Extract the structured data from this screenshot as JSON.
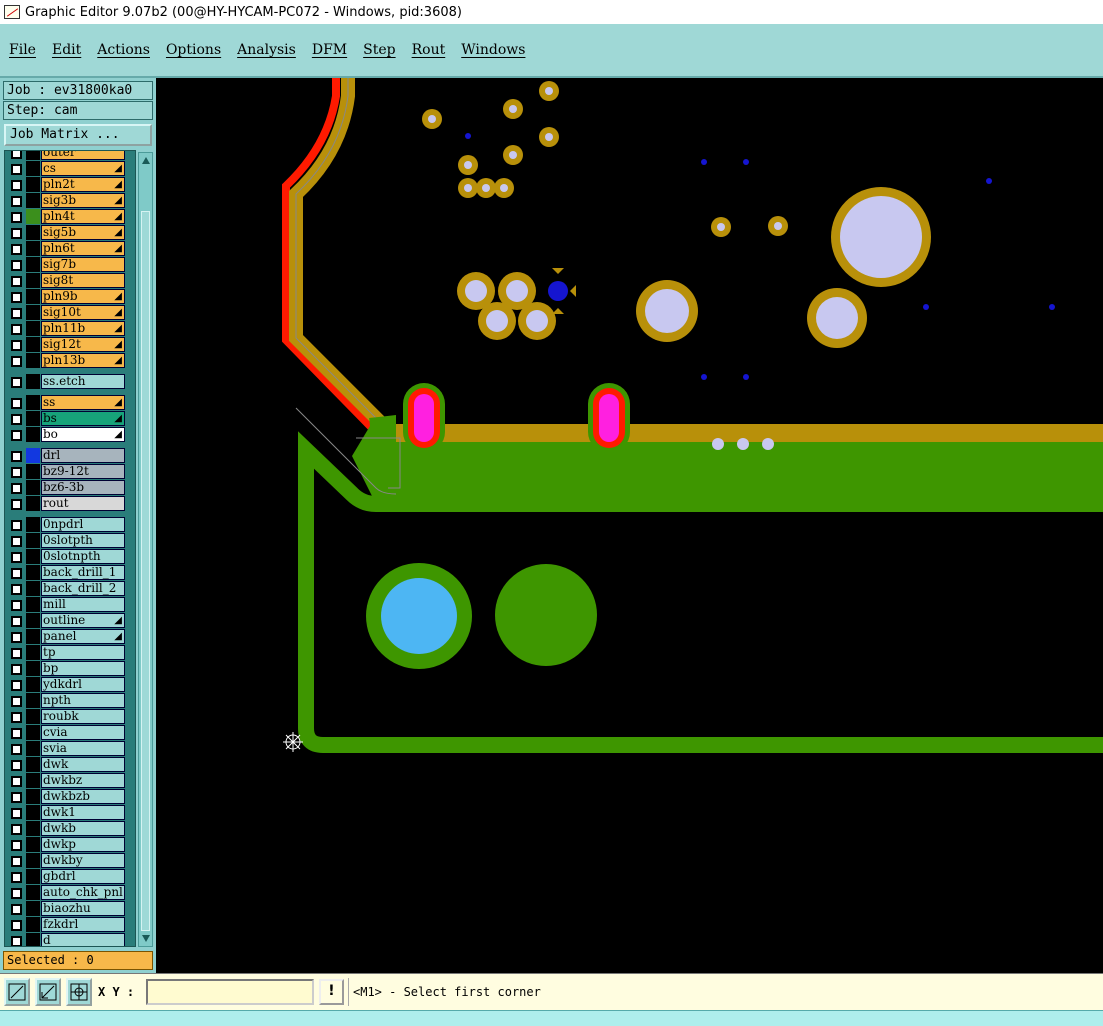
{
  "window": {
    "title": "Graphic Editor 9.07b2 (00@HY-HYCAM-PC072 - Windows, pid:3608)"
  },
  "menu": [
    "File",
    "Edit",
    "Actions",
    "Options",
    "Analysis",
    "DFM",
    "Step",
    "Rout",
    "Windows"
  ],
  "job": {
    "label": "Job : ev31800ka0",
    "step": "Step: cam",
    "matrix_button": "Job Matrix ..."
  },
  "layers": [
    {
      "name": "outer",
      "color": "#f7b84a",
      "swatch": "#000",
      "arrow": false,
      "partial": true
    },
    {
      "name": "cs",
      "color": "#f7b84a",
      "swatch": "#000",
      "arrow": true
    },
    {
      "name": "pln2t",
      "color": "#f7b84a",
      "swatch": "#000",
      "arrow": true
    },
    {
      "name": "sig3b",
      "color": "#f7b84a",
      "swatch": "#000",
      "arrow": true
    },
    {
      "name": "pln4t",
      "color": "#f7b84a",
      "swatch": "#3b8f1c",
      "arrow": true
    },
    {
      "name": "sig5b",
      "color": "#f7b84a",
      "swatch": "#000",
      "arrow": true
    },
    {
      "name": "pln6t",
      "color": "#f7b84a",
      "swatch": "#000",
      "arrow": true
    },
    {
      "name": "sig7b",
      "color": "#f7b84a",
      "swatch": "#000",
      "arrow": false
    },
    {
      "name": "sig8t",
      "color": "#f7b84a",
      "swatch": "#000",
      "arrow": false
    },
    {
      "name": "pln9b",
      "color": "#f7b84a",
      "swatch": "#000",
      "arrow": true
    },
    {
      "name": "sig10t",
      "color": "#f7b84a",
      "swatch": "#000",
      "arrow": true
    },
    {
      "name": "pln11b",
      "color": "#f7b84a",
      "swatch": "#000",
      "arrow": true
    },
    {
      "name": "sig12t",
      "color": "#f7b84a",
      "swatch": "#000",
      "arrow": true
    },
    {
      "name": "pln13b",
      "color": "#f7b84a",
      "swatch": "#000",
      "arrow": true
    },
    {
      "name": "ss.etch",
      "color": "#9fd8d6",
      "swatch": "#000",
      "arrow": false,
      "gap": true
    },
    {
      "name": "ss",
      "color": "#f7b84a",
      "swatch": "#000",
      "arrow": true,
      "gap": true
    },
    {
      "name": "bs",
      "color": "#17a37a",
      "swatch": "#000",
      "arrow": true
    },
    {
      "name": "bo",
      "color": "#ffffff",
      "swatch": "#000",
      "arrow": true
    },
    {
      "name": "drl",
      "color": "#a7b4bd",
      "swatch": "#1238e0",
      "arrow": false,
      "gap": true
    },
    {
      "name": "bz9-12t",
      "color": "#a7b4bd",
      "swatch": "#000",
      "arrow": false
    },
    {
      "name": "bz6-3b",
      "color": "#a7b4bd",
      "swatch": "#000",
      "arrow": false
    },
    {
      "name": "rout",
      "color": "#d8d8d8",
      "swatch": "#000",
      "arrow": false
    },
    {
      "name": "0npdrl",
      "color": "#9fd8d6",
      "swatch": "#000",
      "arrow": false,
      "gap": true
    },
    {
      "name": "0slotpth",
      "color": "#9fd8d6",
      "swatch": "#000",
      "arrow": false
    },
    {
      "name": "0slotnpth",
      "color": "#9fd8d6",
      "swatch": "#000",
      "arrow": false
    },
    {
      "name": "back_drill_1",
      "color": "#9fd8d6",
      "swatch": "#000",
      "arrow": false
    },
    {
      "name": "back_drill_2",
      "color": "#9fd8d6",
      "swatch": "#000",
      "arrow": false
    },
    {
      "name": "mill",
      "color": "#9fd8d6",
      "swatch": "#000",
      "arrow": false
    },
    {
      "name": "outline",
      "color": "#9fd8d6",
      "swatch": "#000",
      "arrow": true
    },
    {
      "name": "panel",
      "color": "#9fd8d6",
      "swatch": "#000",
      "arrow": true
    },
    {
      "name": "tp",
      "color": "#9fd8d6",
      "swatch": "#000",
      "arrow": false
    },
    {
      "name": "bp",
      "color": "#9fd8d6",
      "swatch": "#000",
      "arrow": false
    },
    {
      "name": "ydkdrl",
      "color": "#9fd8d6",
      "swatch": "#000",
      "arrow": false
    },
    {
      "name": "npth",
      "color": "#9fd8d6",
      "swatch": "#000",
      "arrow": false
    },
    {
      "name": "roubk",
      "color": "#9fd8d6",
      "swatch": "#000",
      "arrow": false
    },
    {
      "name": "cvia",
      "color": "#9fd8d6",
      "swatch": "#000",
      "arrow": false
    },
    {
      "name": "svia",
      "color": "#9fd8d6",
      "swatch": "#000",
      "arrow": false
    },
    {
      "name": "dwk",
      "color": "#9fd8d6",
      "swatch": "#000",
      "arrow": false
    },
    {
      "name": "dwkbz",
      "color": "#9fd8d6",
      "swatch": "#000",
      "arrow": false
    },
    {
      "name": "dwkbzb",
      "color": "#9fd8d6",
      "swatch": "#000",
      "arrow": false
    },
    {
      "name": "dwk1",
      "color": "#9fd8d6",
      "swatch": "#000",
      "arrow": false
    },
    {
      "name": "dwkb",
      "color": "#9fd8d6",
      "swatch": "#000",
      "arrow": false
    },
    {
      "name": "dwkp",
      "color": "#9fd8d6",
      "swatch": "#000",
      "arrow": false
    },
    {
      "name": "dwkby",
      "color": "#9fd8d6",
      "swatch": "#000",
      "arrow": false
    },
    {
      "name": "gbdrl",
      "color": "#9fd8d6",
      "swatch": "#000",
      "arrow": false
    },
    {
      "name": "auto_chk_pnl",
      "color": "#9fd8d6",
      "swatch": "#000",
      "arrow": false
    },
    {
      "name": "biaozhu",
      "color": "#9fd8d6",
      "swatch": "#000",
      "arrow": false
    },
    {
      "name": "fzkdrl",
      "color": "#9fd8d6",
      "swatch": "#000",
      "arrow": false
    },
    {
      "name": "d",
      "color": "#9fd8d6",
      "swatch": "#000",
      "arrow": false,
      "partial": true
    }
  ],
  "selected": "Selected : 0",
  "status": {
    "xy_label": "X Y :",
    "xy_value": "",
    "info_button": "!",
    "prompt": "<M1> - Select first corner"
  },
  "colors": {
    "copper": "#b8900a",
    "solder_mask": "#3e9600",
    "pad": "#c8c8f0",
    "via": "#1515d0",
    "trace_red": "#ff1a00",
    "magenta": "#ff20e0",
    "hole_blue": "#4db6f3"
  }
}
